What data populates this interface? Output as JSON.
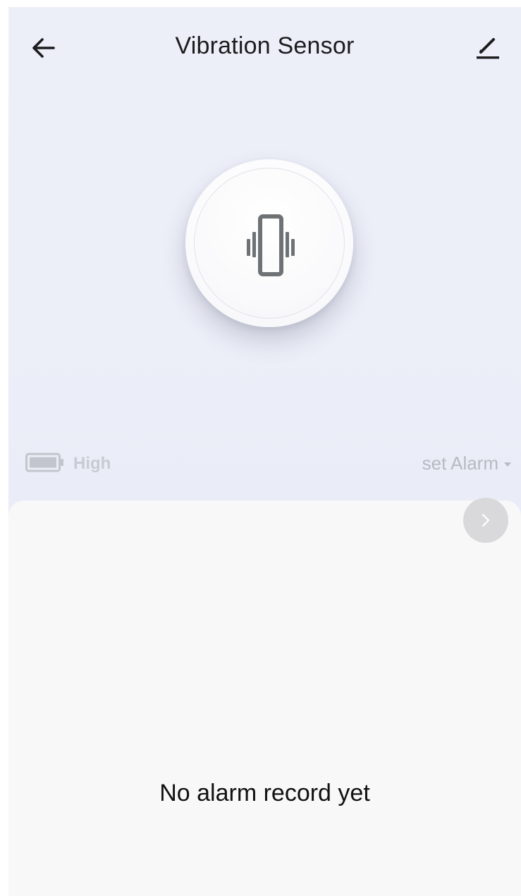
{
  "header": {
    "title": "Vibration Sensor",
    "back_icon": "arrow-left-icon",
    "edit_icon": "pencil-icon"
  },
  "sensor": {
    "icon": "vibration-icon"
  },
  "status": {
    "battery_icon": "battery-icon",
    "battery_level": "High",
    "alarm_select_label": "set Alarm"
  },
  "records": {
    "history_icon": "chevron-right-icon",
    "empty_message": "No alarm record yet"
  },
  "colors": {
    "background": "#ebedf8",
    "panel": "#f8f8f8",
    "icon_gray": "#6f7275",
    "muted_text": "#b8bac2"
  }
}
